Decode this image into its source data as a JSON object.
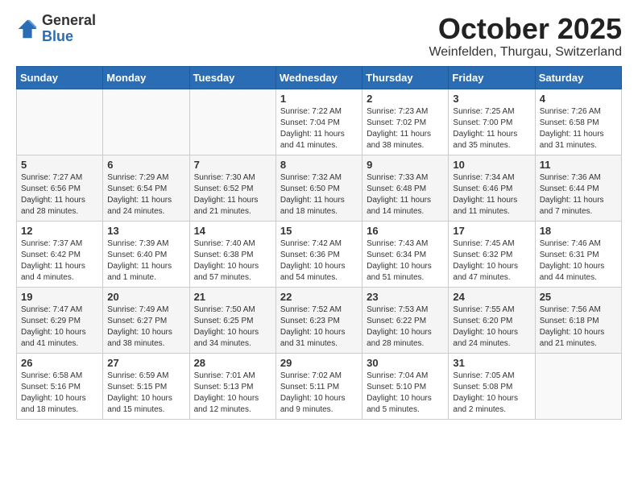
{
  "header": {
    "logo_general": "General",
    "logo_blue": "Blue",
    "month": "October 2025",
    "location": "Weinfelden, Thurgau, Switzerland"
  },
  "weekdays": [
    "Sunday",
    "Monday",
    "Tuesday",
    "Wednesday",
    "Thursday",
    "Friday",
    "Saturday"
  ],
  "weeks": [
    [
      {
        "day": "",
        "content": ""
      },
      {
        "day": "",
        "content": ""
      },
      {
        "day": "",
        "content": ""
      },
      {
        "day": "1",
        "content": "Sunrise: 7:22 AM\nSunset: 7:04 PM\nDaylight: 11 hours\nand 41 minutes."
      },
      {
        "day": "2",
        "content": "Sunrise: 7:23 AM\nSunset: 7:02 PM\nDaylight: 11 hours\nand 38 minutes."
      },
      {
        "day": "3",
        "content": "Sunrise: 7:25 AM\nSunset: 7:00 PM\nDaylight: 11 hours\nand 35 minutes."
      },
      {
        "day": "4",
        "content": "Sunrise: 7:26 AM\nSunset: 6:58 PM\nDaylight: 11 hours\nand 31 minutes."
      }
    ],
    [
      {
        "day": "5",
        "content": "Sunrise: 7:27 AM\nSunset: 6:56 PM\nDaylight: 11 hours\nand 28 minutes."
      },
      {
        "day": "6",
        "content": "Sunrise: 7:29 AM\nSunset: 6:54 PM\nDaylight: 11 hours\nand 24 minutes."
      },
      {
        "day": "7",
        "content": "Sunrise: 7:30 AM\nSunset: 6:52 PM\nDaylight: 11 hours\nand 21 minutes."
      },
      {
        "day": "8",
        "content": "Sunrise: 7:32 AM\nSunset: 6:50 PM\nDaylight: 11 hours\nand 18 minutes."
      },
      {
        "day": "9",
        "content": "Sunrise: 7:33 AM\nSunset: 6:48 PM\nDaylight: 11 hours\nand 14 minutes."
      },
      {
        "day": "10",
        "content": "Sunrise: 7:34 AM\nSunset: 6:46 PM\nDaylight: 11 hours\nand 11 minutes."
      },
      {
        "day": "11",
        "content": "Sunrise: 7:36 AM\nSunset: 6:44 PM\nDaylight: 11 hours\nand 7 minutes."
      }
    ],
    [
      {
        "day": "12",
        "content": "Sunrise: 7:37 AM\nSunset: 6:42 PM\nDaylight: 11 hours\nand 4 minutes."
      },
      {
        "day": "13",
        "content": "Sunrise: 7:39 AM\nSunset: 6:40 PM\nDaylight: 11 hours\nand 1 minute."
      },
      {
        "day": "14",
        "content": "Sunrise: 7:40 AM\nSunset: 6:38 PM\nDaylight: 10 hours\nand 57 minutes."
      },
      {
        "day": "15",
        "content": "Sunrise: 7:42 AM\nSunset: 6:36 PM\nDaylight: 10 hours\nand 54 minutes."
      },
      {
        "day": "16",
        "content": "Sunrise: 7:43 AM\nSunset: 6:34 PM\nDaylight: 10 hours\nand 51 minutes."
      },
      {
        "day": "17",
        "content": "Sunrise: 7:45 AM\nSunset: 6:32 PM\nDaylight: 10 hours\nand 47 minutes."
      },
      {
        "day": "18",
        "content": "Sunrise: 7:46 AM\nSunset: 6:31 PM\nDaylight: 10 hours\nand 44 minutes."
      }
    ],
    [
      {
        "day": "19",
        "content": "Sunrise: 7:47 AM\nSunset: 6:29 PM\nDaylight: 10 hours\nand 41 minutes."
      },
      {
        "day": "20",
        "content": "Sunrise: 7:49 AM\nSunset: 6:27 PM\nDaylight: 10 hours\nand 38 minutes."
      },
      {
        "day": "21",
        "content": "Sunrise: 7:50 AM\nSunset: 6:25 PM\nDaylight: 10 hours\nand 34 minutes."
      },
      {
        "day": "22",
        "content": "Sunrise: 7:52 AM\nSunset: 6:23 PM\nDaylight: 10 hours\nand 31 minutes."
      },
      {
        "day": "23",
        "content": "Sunrise: 7:53 AM\nSunset: 6:22 PM\nDaylight: 10 hours\nand 28 minutes."
      },
      {
        "day": "24",
        "content": "Sunrise: 7:55 AM\nSunset: 6:20 PM\nDaylight: 10 hours\nand 24 minutes."
      },
      {
        "day": "25",
        "content": "Sunrise: 7:56 AM\nSunset: 6:18 PM\nDaylight: 10 hours\nand 21 minutes."
      }
    ],
    [
      {
        "day": "26",
        "content": "Sunrise: 6:58 AM\nSunset: 5:16 PM\nDaylight: 10 hours\nand 18 minutes."
      },
      {
        "day": "27",
        "content": "Sunrise: 6:59 AM\nSunset: 5:15 PM\nDaylight: 10 hours\nand 15 minutes."
      },
      {
        "day": "28",
        "content": "Sunrise: 7:01 AM\nSunset: 5:13 PM\nDaylight: 10 hours\nand 12 minutes."
      },
      {
        "day": "29",
        "content": "Sunrise: 7:02 AM\nSunset: 5:11 PM\nDaylight: 10 hours\nand 9 minutes."
      },
      {
        "day": "30",
        "content": "Sunrise: 7:04 AM\nSunset: 5:10 PM\nDaylight: 10 hours\nand 5 minutes."
      },
      {
        "day": "31",
        "content": "Sunrise: 7:05 AM\nSunset: 5:08 PM\nDaylight: 10 hours\nand 2 minutes."
      },
      {
        "day": "",
        "content": ""
      }
    ]
  ]
}
